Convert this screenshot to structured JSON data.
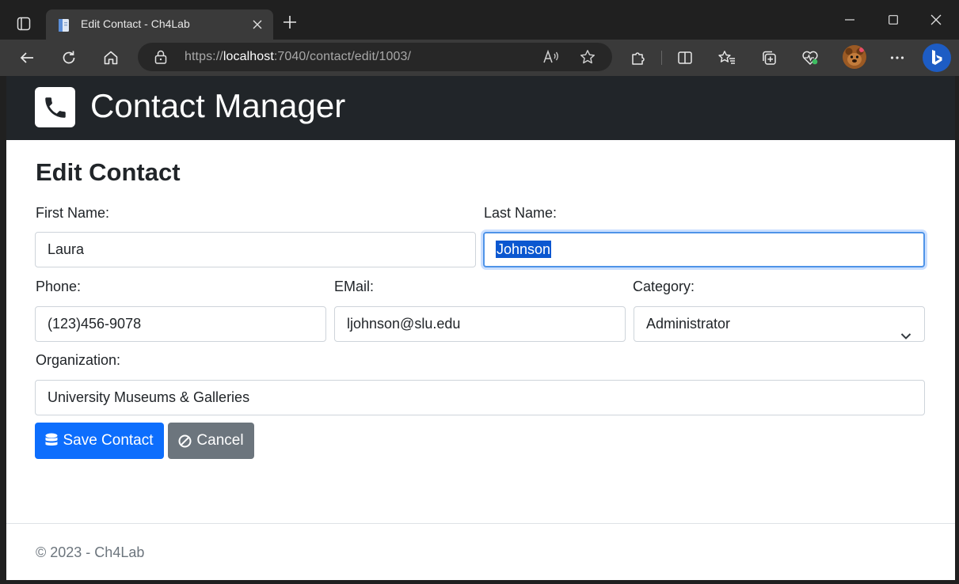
{
  "browser": {
    "tab_title": "Edit Contact - Ch4Lab",
    "url_prefix": "https://",
    "url_host": "localhost",
    "url_rest": ":7040/contact/edit/1003/"
  },
  "app": {
    "brand": "Contact Manager"
  },
  "form": {
    "title": "Edit Contact",
    "first_name_label": "First Name:",
    "first_name_value": "Laura",
    "last_name_label": "Last Name:",
    "last_name_value": "Johnson",
    "phone_label": "Phone:",
    "phone_value": "(123)456-9078",
    "email_label": "EMail:",
    "email_value": "ljohnson@slu.edu",
    "category_label": "Category:",
    "category_value": "Administrator",
    "organization_label": "Organization:",
    "organization_value": "University Museums & Galleries",
    "save_label": "Save Contact",
    "cancel_label": "Cancel"
  },
  "footer": {
    "text": "© 2023 - Ch4Lab"
  },
  "colors": {
    "primary": "#0d6efd",
    "secondary": "#6c757d",
    "navbar": "#212529",
    "focus": "#4e93e8"
  }
}
